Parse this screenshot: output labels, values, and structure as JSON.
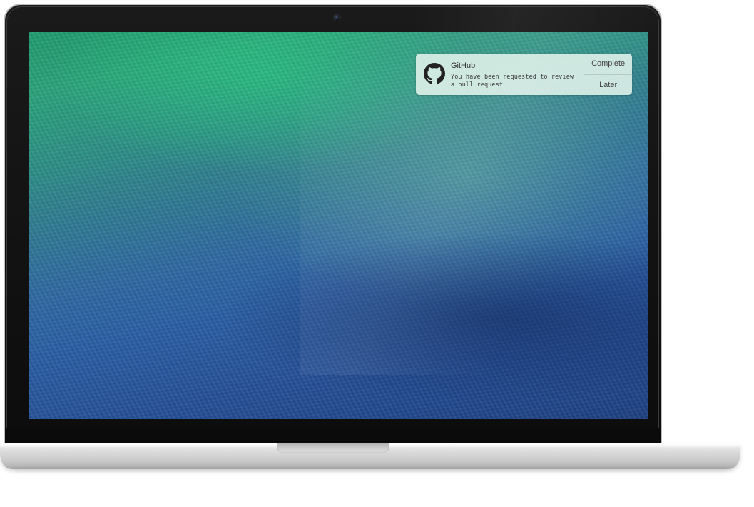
{
  "device": {
    "type": "laptop",
    "wallpaper": "ocean-wave"
  },
  "notification": {
    "app_name": "GitHub",
    "icon": "github-octocat-icon",
    "message": "You have been requested to review a pull request",
    "actions": [
      {
        "label": "Complete"
      },
      {
        "label": "Later"
      }
    ]
  },
  "colors": {
    "wallpaper_top": "#2aa27a",
    "wallpaper_bottom": "#1d3f80",
    "notification_bg": "#e2f4ec",
    "bezel": "#0c0c0c",
    "chassis": "#d0d0d0"
  }
}
